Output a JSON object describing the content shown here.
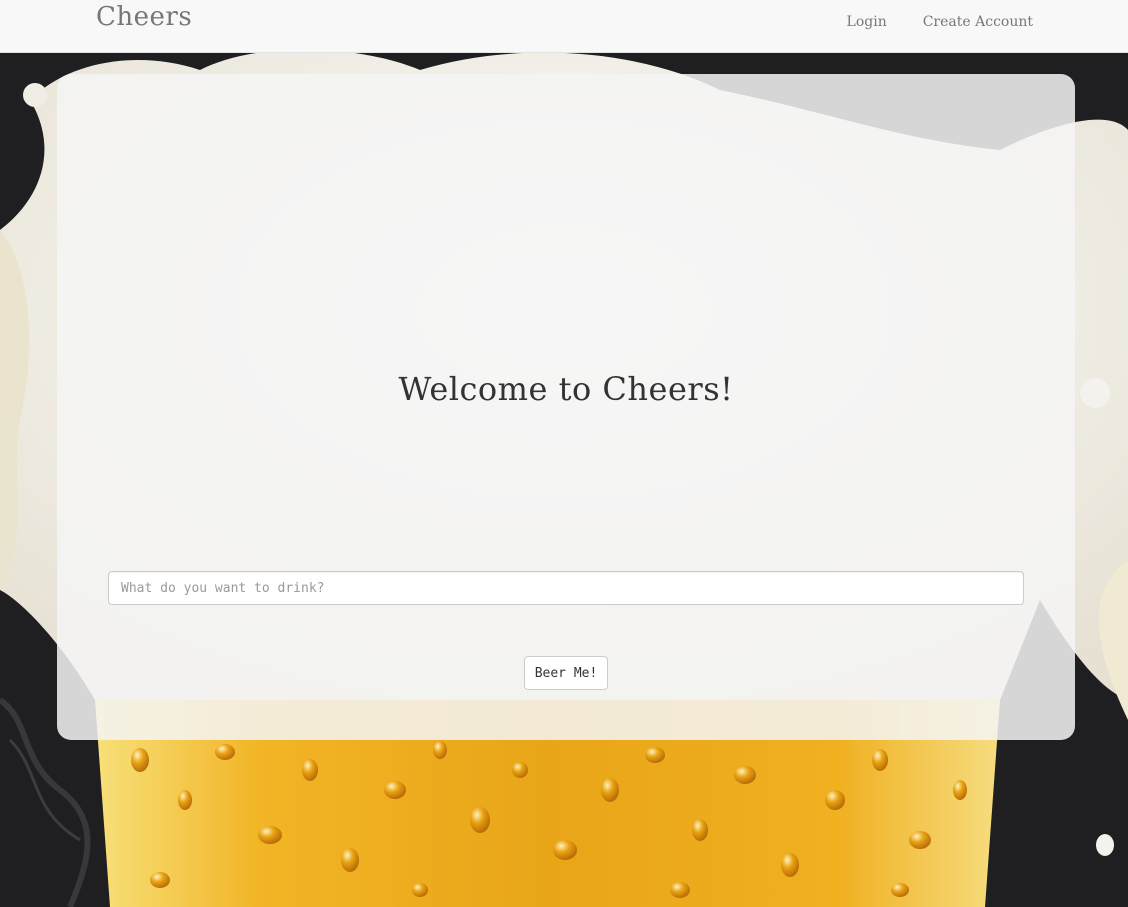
{
  "navbar": {
    "brand": "Cheers",
    "links": [
      {
        "label": "Login"
      },
      {
        "label": "Create Account"
      }
    ]
  },
  "main": {
    "heading": "Welcome to Cheers!",
    "search": {
      "placeholder": "What do you want to drink?",
      "value": ""
    },
    "submit_label": "Beer Me!"
  },
  "colors": {
    "page_background": "#1f1f21",
    "navbar_background": "#f8f8f8",
    "nav_text": "#777777",
    "heading_text": "#333333",
    "beer_gold": "#e8a518",
    "foam": "#f2f0eb"
  }
}
